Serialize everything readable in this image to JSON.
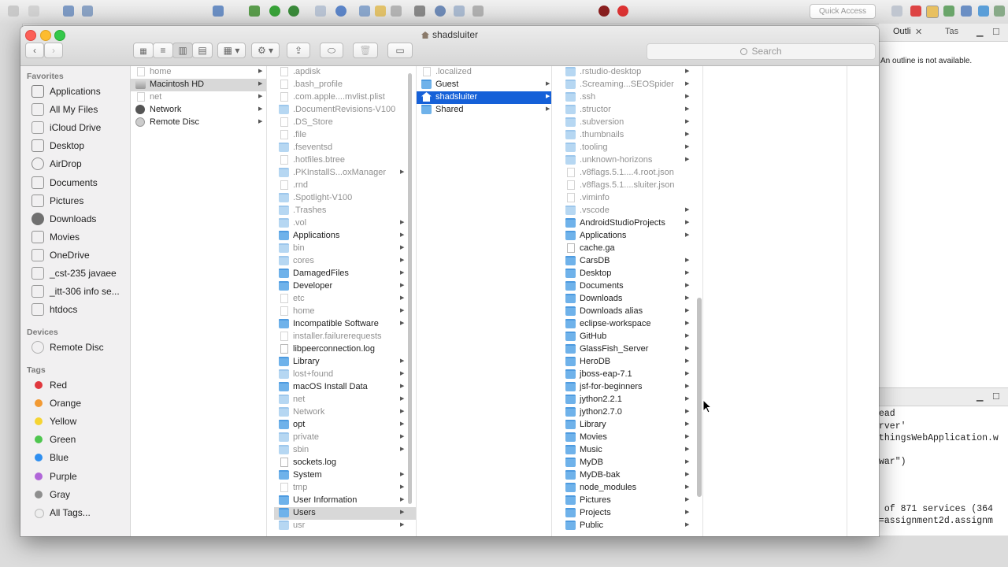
{
  "eclipse": {
    "quick_access": "Quick Access",
    "outline_tab": "Outli",
    "tasks_tab": "Tas",
    "outline_message": "An outline is not available.",
    "console_lines": [
      "ead",
      "rver'",
      "thingsWebApplication.w",
      "",
      "war\")",
      "",
      "",
      " of 871 services (364",
      "=assignment2d.assignm"
    ]
  },
  "finder": {
    "title": "shadsluiter",
    "search_placeholder": "Search",
    "sidebar": {
      "favorites_header": "Favorites",
      "favorites": [
        {
          "label": "Applications",
          "icon": "applications-icon"
        },
        {
          "label": "All My Files",
          "icon": "all-my-files-icon"
        },
        {
          "label": "iCloud Drive",
          "icon": "cloud-icon"
        },
        {
          "label": "Desktop",
          "icon": "desktop-icon"
        },
        {
          "label": "AirDrop",
          "icon": "airdrop-icon"
        },
        {
          "label": "Documents",
          "icon": "documents-icon"
        },
        {
          "label": "Pictures",
          "icon": "pictures-icon"
        },
        {
          "label": "Downloads",
          "icon": "downloads-icon"
        },
        {
          "label": "Movies",
          "icon": "movies-icon"
        },
        {
          "label": "OneDrive",
          "icon": "folder-icon"
        },
        {
          "label": "_cst-235 javaee",
          "icon": "folder-icon"
        },
        {
          "label": "_itt-306 info se...",
          "icon": "folder-icon"
        },
        {
          "label": "htdocs",
          "icon": "folder-icon"
        }
      ],
      "devices_header": "Devices",
      "devices": [
        {
          "label": "Remote Disc",
          "icon": "disc-icon"
        }
      ],
      "tags_header": "Tags",
      "tags": [
        {
          "label": "Red",
          "color": "#e0383e"
        },
        {
          "label": "Orange",
          "color": "#f29a33"
        },
        {
          "label": "Yellow",
          "color": "#f5d432"
        },
        {
          "label": "Green",
          "color": "#4fc64f"
        },
        {
          "label": "Blue",
          "color": "#2f8ff0"
        },
        {
          "label": "Purple",
          "color": "#b066d8"
        },
        {
          "label": "Gray",
          "color": "#8e8e8e"
        },
        {
          "label": "All Tags...",
          "color": "#d8d8d8"
        }
      ]
    },
    "columns": [
      {
        "items": [
          {
            "name": "home",
            "kind": "doc",
            "dim": true,
            "arrow": true
          },
          {
            "name": "Macintosh HD",
            "kind": "disk",
            "dim": false,
            "arrow": true,
            "state": "hl"
          },
          {
            "name": "net",
            "kind": "doc",
            "dim": true,
            "arrow": true
          },
          {
            "name": "Network",
            "kind": "globe",
            "dim": false,
            "arrow": true
          },
          {
            "name": "Remote Disc",
            "kind": "disc",
            "dim": false,
            "arrow": true
          }
        ]
      },
      {
        "items": [
          {
            "name": ".apdisk",
            "kind": "doc",
            "dim": true,
            "arrow": false
          },
          {
            "name": ".bash_profile",
            "kind": "doc",
            "dim": true,
            "arrow": false
          },
          {
            "name": ".com.apple....mvlist.plist",
            "kind": "doc",
            "dim": true,
            "arrow": false
          },
          {
            "name": ".DocumentRevisions-V100",
            "kind": "folder",
            "dim": true,
            "arrow": false
          },
          {
            "name": ".DS_Store",
            "kind": "doc",
            "dim": true,
            "arrow": false
          },
          {
            "name": ".file",
            "kind": "doc",
            "dim": true,
            "arrow": false
          },
          {
            "name": ".fseventsd",
            "kind": "folder",
            "dim": true,
            "arrow": false
          },
          {
            "name": ".hotfiles.btree",
            "kind": "doc",
            "dim": true,
            "arrow": false
          },
          {
            "name": ".PKInstallS...oxManager",
            "kind": "folder",
            "dim": true,
            "arrow": true
          },
          {
            "name": ".rnd",
            "kind": "doc",
            "dim": true,
            "arrow": false
          },
          {
            "name": ".Spotlight-V100",
            "kind": "folder",
            "dim": true,
            "arrow": false
          },
          {
            "name": ".Trashes",
            "kind": "folder",
            "dim": true,
            "arrow": false
          },
          {
            "name": ".vol",
            "kind": "folder",
            "dim": true,
            "arrow": true
          },
          {
            "name": "Applications",
            "kind": "folder",
            "dim": false,
            "arrow": true
          },
          {
            "name": "bin",
            "kind": "folder",
            "dim": true,
            "arrow": true
          },
          {
            "name": "cores",
            "kind": "folder",
            "dim": true,
            "arrow": true
          },
          {
            "name": "DamagedFiles",
            "kind": "folder",
            "dim": false,
            "arrow": true
          },
          {
            "name": "Developer",
            "kind": "folder",
            "dim": false,
            "arrow": true
          },
          {
            "name": "etc",
            "kind": "doc",
            "dim": true,
            "arrow": true
          },
          {
            "name": "home",
            "kind": "doc",
            "dim": true,
            "arrow": true
          },
          {
            "name": "Incompatible Software",
            "kind": "folder",
            "dim": false,
            "arrow": true
          },
          {
            "name": "installer.failurerequests",
            "kind": "doc",
            "dim": true,
            "arrow": false
          },
          {
            "name": "libpeerconnection.log",
            "kind": "doc",
            "dim": false,
            "arrow": false
          },
          {
            "name": "Library",
            "kind": "folder",
            "dim": false,
            "arrow": true
          },
          {
            "name": "lost+found",
            "kind": "folder",
            "dim": true,
            "arrow": true
          },
          {
            "name": "macOS Install Data",
            "kind": "folder",
            "dim": false,
            "arrow": true
          },
          {
            "name": "net",
            "kind": "folder",
            "dim": true,
            "arrow": true
          },
          {
            "name": "Network",
            "kind": "folder",
            "dim": true,
            "arrow": true
          },
          {
            "name": "opt",
            "kind": "folder",
            "dim": false,
            "arrow": true
          },
          {
            "name": "private",
            "kind": "folder",
            "dim": true,
            "arrow": true
          },
          {
            "name": "sbin",
            "kind": "folder",
            "dim": true,
            "arrow": true
          },
          {
            "name": "sockets.log",
            "kind": "doc",
            "dim": false,
            "arrow": false
          },
          {
            "name": "System",
            "kind": "folder",
            "dim": false,
            "arrow": true
          },
          {
            "name": "tmp",
            "kind": "doc",
            "dim": true,
            "arrow": true
          },
          {
            "name": "User Information",
            "kind": "folder",
            "dim": false,
            "arrow": true
          },
          {
            "name": "Users",
            "kind": "folder",
            "dim": false,
            "arrow": true,
            "state": "hl"
          },
          {
            "name": "usr",
            "kind": "folder",
            "dim": true,
            "arrow": true
          }
        ]
      },
      {
        "items": [
          {
            "name": ".localized",
            "kind": "doc",
            "dim": true,
            "arrow": false
          },
          {
            "name": "Guest",
            "kind": "folder",
            "dim": false,
            "arrow": true
          },
          {
            "name": "shadsluiter",
            "kind": "home",
            "dim": false,
            "arrow": true,
            "state": "sel"
          },
          {
            "name": "Shared",
            "kind": "folder",
            "dim": false,
            "arrow": true
          }
        ]
      },
      {
        "items": [
          {
            "name": ".rstudio-desktop",
            "kind": "folder",
            "dim": true,
            "arrow": true
          },
          {
            "name": ".Screaming...SEOSpider",
            "kind": "folder",
            "dim": true,
            "arrow": true
          },
          {
            "name": ".ssh",
            "kind": "folder",
            "dim": true,
            "arrow": true
          },
          {
            "name": ".structor",
            "kind": "folder",
            "dim": true,
            "arrow": true
          },
          {
            "name": ".subversion",
            "kind": "folder",
            "dim": true,
            "arrow": true
          },
          {
            "name": ".thumbnails",
            "kind": "folder",
            "dim": true,
            "arrow": true
          },
          {
            "name": ".tooling",
            "kind": "folder",
            "dim": true,
            "arrow": true
          },
          {
            "name": ".unknown-horizons",
            "kind": "folder",
            "dim": true,
            "arrow": true
          },
          {
            "name": ".v8flags.5.1....4.root.json",
            "kind": "doc",
            "dim": true,
            "arrow": false
          },
          {
            "name": ".v8flags.5.1....sluiter.json",
            "kind": "doc",
            "dim": true,
            "arrow": false
          },
          {
            "name": ".viminfo",
            "kind": "doc",
            "dim": true,
            "arrow": false
          },
          {
            "name": ".vscode",
            "kind": "folder",
            "dim": true,
            "arrow": true
          },
          {
            "name": "AndroidStudioProjects",
            "kind": "folder",
            "dim": false,
            "arrow": true
          },
          {
            "name": "Applications",
            "kind": "folder",
            "dim": false,
            "arrow": true
          },
          {
            "name": "cache.ga",
            "kind": "doc",
            "dim": false,
            "arrow": false
          },
          {
            "name": "CarsDB",
            "kind": "folder",
            "dim": false,
            "arrow": true
          },
          {
            "name": "Desktop",
            "kind": "folder",
            "dim": false,
            "arrow": true
          },
          {
            "name": "Documents",
            "kind": "folder",
            "dim": false,
            "arrow": true
          },
          {
            "name": "Downloads",
            "kind": "folder",
            "dim": false,
            "arrow": true
          },
          {
            "name": "Downloads alias",
            "kind": "folder",
            "dim": false,
            "arrow": true
          },
          {
            "name": "eclipse-workspace",
            "kind": "folder",
            "dim": false,
            "arrow": true
          },
          {
            "name": "GitHub",
            "kind": "folder",
            "dim": false,
            "arrow": true
          },
          {
            "name": "GlassFish_Server",
            "kind": "folder",
            "dim": false,
            "arrow": true
          },
          {
            "name": "HeroDB",
            "kind": "folder",
            "dim": false,
            "arrow": true
          },
          {
            "name": "jboss-eap-7.1",
            "kind": "folder",
            "dim": false,
            "arrow": true
          },
          {
            "name": "jsf-for-beginners",
            "kind": "folder",
            "dim": false,
            "arrow": true
          },
          {
            "name": "jython2.2.1",
            "kind": "folder",
            "dim": false,
            "arrow": true
          },
          {
            "name": "jython2.7.0",
            "kind": "folder",
            "dim": false,
            "arrow": true
          },
          {
            "name": "Library",
            "kind": "folder",
            "dim": false,
            "arrow": true
          },
          {
            "name": "Movies",
            "kind": "folder",
            "dim": false,
            "arrow": true
          },
          {
            "name": "Music",
            "kind": "folder",
            "dim": false,
            "arrow": true
          },
          {
            "name": "MyDB",
            "kind": "folder",
            "dim": false,
            "arrow": true
          },
          {
            "name": "MyDB-bak",
            "kind": "folder",
            "dim": false,
            "arrow": true
          },
          {
            "name": "node_modules",
            "kind": "folder",
            "dim": false,
            "arrow": true
          },
          {
            "name": "Pictures",
            "kind": "folder",
            "dim": false,
            "arrow": true
          },
          {
            "name": "Projects",
            "kind": "folder",
            "dim": false,
            "arrow": true
          },
          {
            "name": "Public",
            "kind": "folder",
            "dim": false,
            "arrow": true
          }
        ]
      }
    ]
  }
}
